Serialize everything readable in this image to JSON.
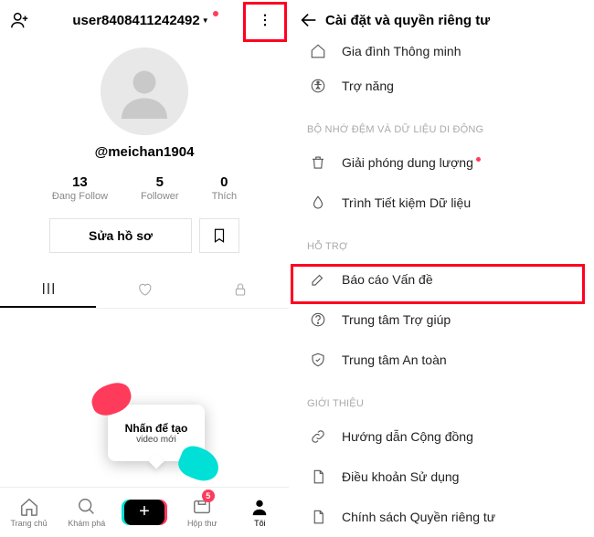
{
  "left": {
    "top_username": "user8408411242492",
    "handle": "@meichan1904",
    "stats": {
      "following_num": "13",
      "following_lbl": "Đang Follow",
      "follower_num": "5",
      "follower_lbl": "Follower",
      "likes_num": "0",
      "likes_lbl": "Thích"
    },
    "edit_label": "Sửa hồ sơ",
    "tooltip_line1": "Nhấn để tạo",
    "tooltip_line2": "video mới",
    "nav": {
      "home": "Trang chủ",
      "discover": "Khám phá",
      "inbox": "Hộp thư",
      "inbox_badge": "5",
      "me": "Tôi"
    }
  },
  "right": {
    "title": "Cài đặt và quyền riêng tư",
    "items": {
      "family": "Gia đình Thông minh",
      "accessibility": "Trợ năng"
    },
    "sec_cache": "BỘ NHỚ ĐỆM VÀ DỮ LIỆU DI ĐỘNG",
    "cache_items": {
      "free": "Giải phóng dung lượng",
      "saver": "Trình Tiết kiệm Dữ liệu"
    },
    "sec_support": "HỖ TRỢ",
    "support_items": {
      "report": "Báo cáo Vấn đề",
      "help": "Trung tâm Trợ giúp",
      "safety": "Trung tâm An toàn"
    },
    "sec_about": "GIỚI THIỆU",
    "about_items": {
      "guide": "Hướng dẫn Cộng đồng",
      "terms": "Điều khoản Sử dụng",
      "privacy": "Chính sách Quyền riêng tư"
    }
  }
}
